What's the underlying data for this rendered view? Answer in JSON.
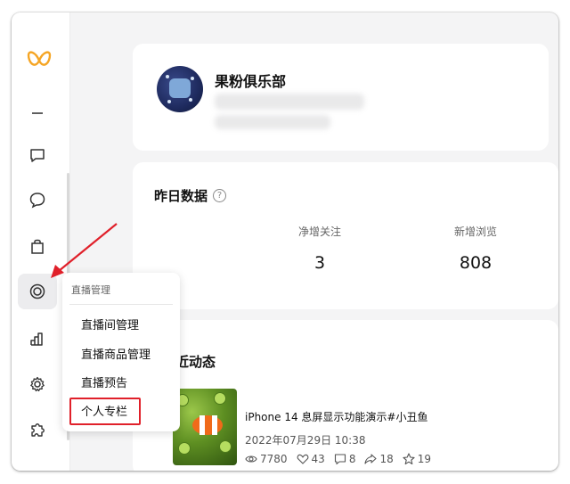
{
  "profile": {
    "name": "果粉俱乐部"
  },
  "stats": {
    "title": "昨日数据",
    "help_symbol": "?",
    "items": [
      {
        "label": "净增关注",
        "value": "3"
      },
      {
        "label": "新增浏览",
        "value": "808"
      }
    ]
  },
  "activity": {
    "title_partial": "近动态",
    "post": {
      "title": "iPhone 14 息屏显示功能演示#小丑鱼",
      "date": "2022年07月29日 10:38",
      "views": "7780",
      "likes": "43",
      "comments": "8",
      "shares": "18",
      "favorites": "19"
    }
  },
  "dropdown": {
    "header": "直播管理",
    "items": [
      "直播间管理",
      "直播商品管理",
      "直播预告",
      "个人专栏"
    ]
  },
  "sidebar": {
    "icons": [
      "logo-icon",
      "minus-icon",
      "message-square-icon",
      "chat-bubble-icon",
      "shopping-bag-icon",
      "live-target-icon",
      "bar-chart-icon",
      "gear-icon",
      "puzzle-icon"
    ]
  },
  "colors": {
    "logo": "#f5a524",
    "highlight": "#e0202a",
    "arrow": "#e0202a"
  }
}
